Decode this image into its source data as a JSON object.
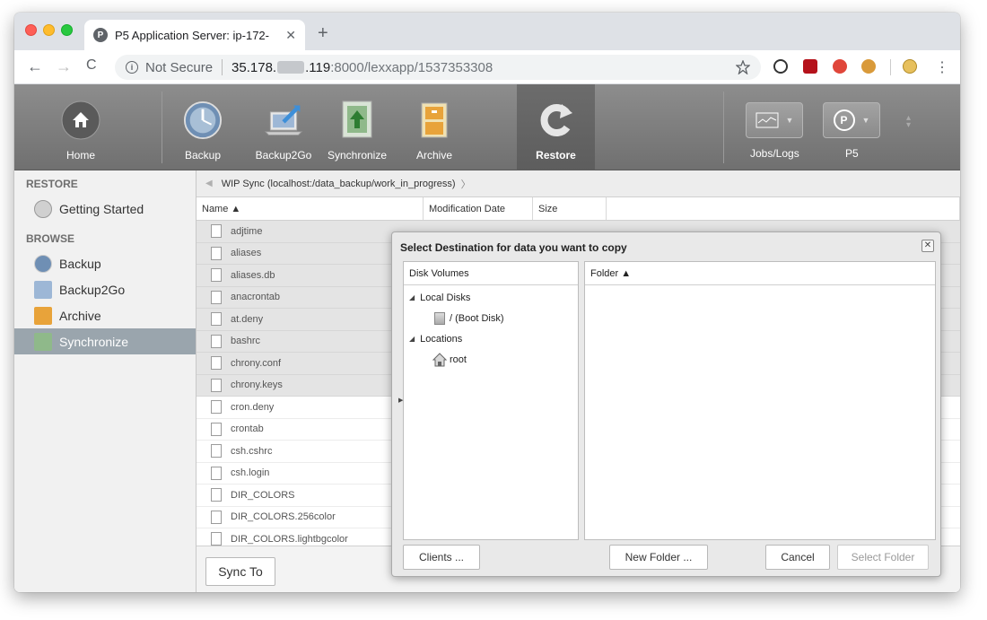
{
  "browser": {
    "tab_title": "P5 Application Server: ip-172-",
    "tab_favicon": "P",
    "tab_close": "✕",
    "new_tab": "+",
    "nav": {
      "back": "←",
      "forward": "→",
      "reload": "C"
    },
    "omnibox": {
      "info": "i",
      "security": "Not Secure",
      "host": "35.178.",
      "host_hidden": "   ",
      "host_rest": ".119",
      "path": ":8000/lexxapp/1537353308"
    }
  },
  "appbar": {
    "buttons": [
      {
        "label": "Home"
      },
      {
        "label": "Backup"
      },
      {
        "label": "Backup2Go"
      },
      {
        "label": "Synchronize"
      },
      {
        "label": "Archive"
      },
      {
        "label": "Restore"
      }
    ],
    "right": [
      {
        "label": "Jobs/Logs"
      },
      {
        "label": "P5"
      }
    ]
  },
  "sidebar": {
    "restore_header": "RESTORE",
    "getting_started": "Getting Started",
    "browse_header": "BROWSE",
    "items": [
      {
        "label": "Backup"
      },
      {
        "label": "Backup2Go"
      },
      {
        "label": "Archive"
      },
      {
        "label": "Synchronize"
      }
    ]
  },
  "main": {
    "breadcrumb": "WIP Sync (localhost:/data_backup/work_in_progress)",
    "columns": {
      "name": "Name ▲",
      "modified": "Modification Date",
      "size": "Size"
    },
    "files": [
      "adjtime",
      "aliases",
      "aliases.db",
      "anacrontab",
      "at.deny",
      "bashrc",
      "chrony.conf",
      "chrony.keys",
      "cron.deny",
      "crontab",
      "csh.cshrc",
      "csh.login",
      "DIR_COLORS",
      "DIR_COLORS.256color",
      "DIR_COLORS.lightbgcolor"
    ],
    "sync_to": "Sync To"
  },
  "dialog": {
    "title": "Select Destination for data you want to copy",
    "close": "✕",
    "left_header": "Disk Volumes",
    "right_header": "Folder ▲",
    "local_disks": "Local Disks",
    "boot_disk": "/ (Boot Disk)",
    "locations": "Locations",
    "root": "root",
    "clients_button": "Clients ...",
    "new_folder_button": "New Folder ...",
    "cancel_button": "Cancel",
    "select_folder_button": "Select Folder"
  },
  "colors": {
    "appbar": "#7b7b7b",
    "sidebar_selected": "#9aa5ad",
    "tab_red": "#fe5f57",
    "tab_yellow": "#febc2e",
    "tab_green": "#28c840"
  }
}
